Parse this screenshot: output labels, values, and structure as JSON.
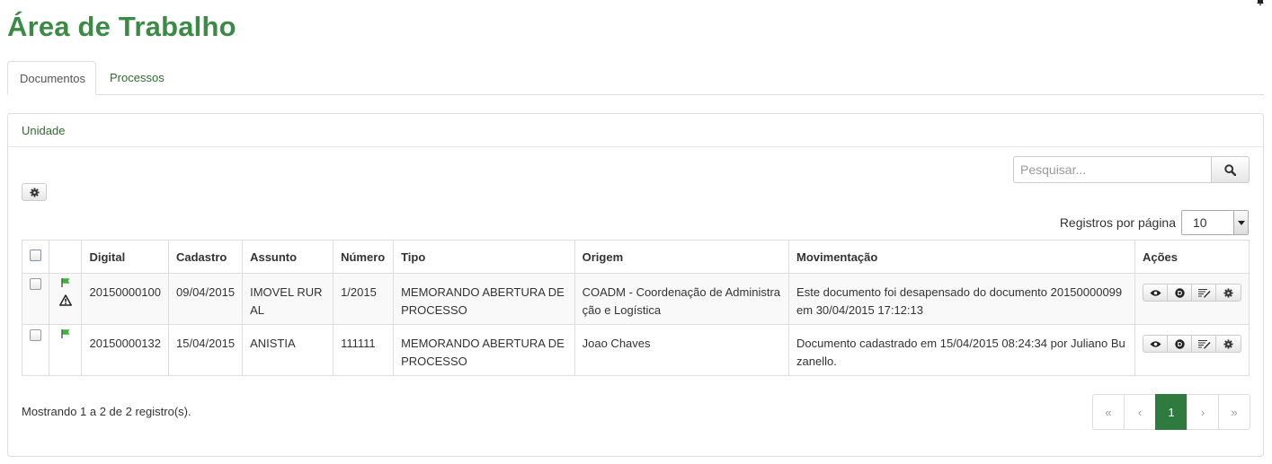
{
  "title": "Área de Trabalho",
  "tabs": [
    {
      "label": "Documentos",
      "active": true
    },
    {
      "label": "Processos",
      "active": false
    }
  ],
  "panel": {
    "heading": "Unidade"
  },
  "search": {
    "placeholder": "Pesquisar..."
  },
  "per_page": {
    "label": "Registros por página",
    "value": "10"
  },
  "table": {
    "headers": {
      "digital": "Digital",
      "cadastro": "Cadastro",
      "assunto": "Assunto",
      "numero": "Número",
      "tipo": "Tipo",
      "origem": "Origem",
      "movimentacao": "Movimentação",
      "acoes": "Ações"
    },
    "rows": [
      {
        "digital": "20150000100",
        "cadastro": "09/04/2015",
        "assunto": "IMOVEL RURAL",
        "numero": "1/2015",
        "tipo": "MEMORANDO ABERTURA DE PROCESSO",
        "origem": "COADM - Coordenação de Administração e Logística",
        "movimentacao": "Este documento foi desapensado do documento 20150000099 em 30/04/2015 17:12:13",
        "flag_icon": "green-flag-icon",
        "warning_icon": "warning-icon"
      },
      {
        "digital": "20150000132",
        "cadastro": "15/04/2015",
        "assunto": "ANISTIA",
        "numero": "111111",
        "tipo": "MEMORANDO ABERTURA DE PROCESSO",
        "origem": "Joao Chaves",
        "movimentacao": "Documento cadastrado em 15/04/2015 08:24:34 por Juliano Buzanello.",
        "flag_icon": "green-flag-icon"
      }
    ]
  },
  "footer": {
    "info": "Mostrando 1 a 2 de 2 registro(s)."
  },
  "pagination": {
    "first": "«",
    "prev": "‹",
    "current": "1",
    "next": "›",
    "last": "»"
  },
  "colors": {
    "title_green": "#3b8a45",
    "link_green": "#2f6a2f",
    "active_page": "#2f7a3e",
    "flag_green": "#3cb33c"
  }
}
